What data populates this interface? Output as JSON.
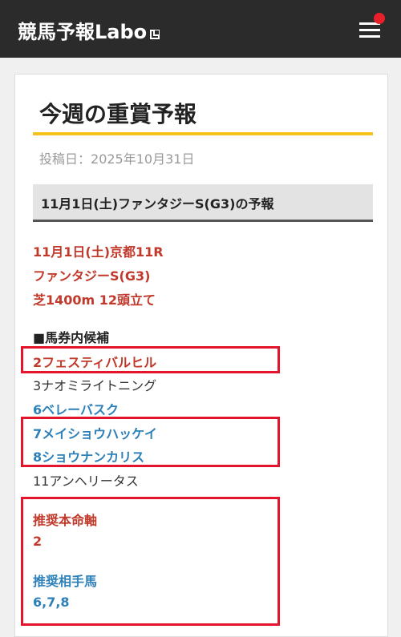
{
  "header": {
    "logo_text": "競馬予報Labo",
    "menu_icon": "hamburger-menu-icon",
    "notification_color": "#e8202a"
  },
  "article": {
    "title": "今週の重賞予報",
    "post_date_label": "投稿日：",
    "post_date": "2025年10月31日",
    "section_heading": "11月1日(土)ファンタジーS(G3)の予報",
    "race_lines": [
      "11月1日(土)京都11R",
      "ファンタジーS(G3)",
      "芝1400m 12頭立て"
    ],
    "candidates_heading": "■馬券内候補",
    "candidates": [
      {
        "text": "2フェスティバルヒル",
        "style": "red"
      },
      {
        "text": "3ナオミライトニング",
        "style": "plain"
      },
      {
        "text": "6ベレーバスク",
        "style": "blue"
      },
      {
        "text": "7メイショウハッケイ",
        "style": "blue"
      },
      {
        "text": "8ショウナンカリス",
        "style": "blue"
      },
      {
        "text": "11アンヘリータス",
        "style": "plain"
      }
    ],
    "recommend_main_label": "推奨本命軸",
    "recommend_main_value": "2",
    "recommend_partner_label": "推奨相手馬",
    "recommend_partner_value": "6,7,8"
  },
  "colors": {
    "accent_yellow": "#f3c21b",
    "red_text": "#c0392b",
    "blue_text": "#2e80b9",
    "highlight_box": "#e3142b"
  }
}
